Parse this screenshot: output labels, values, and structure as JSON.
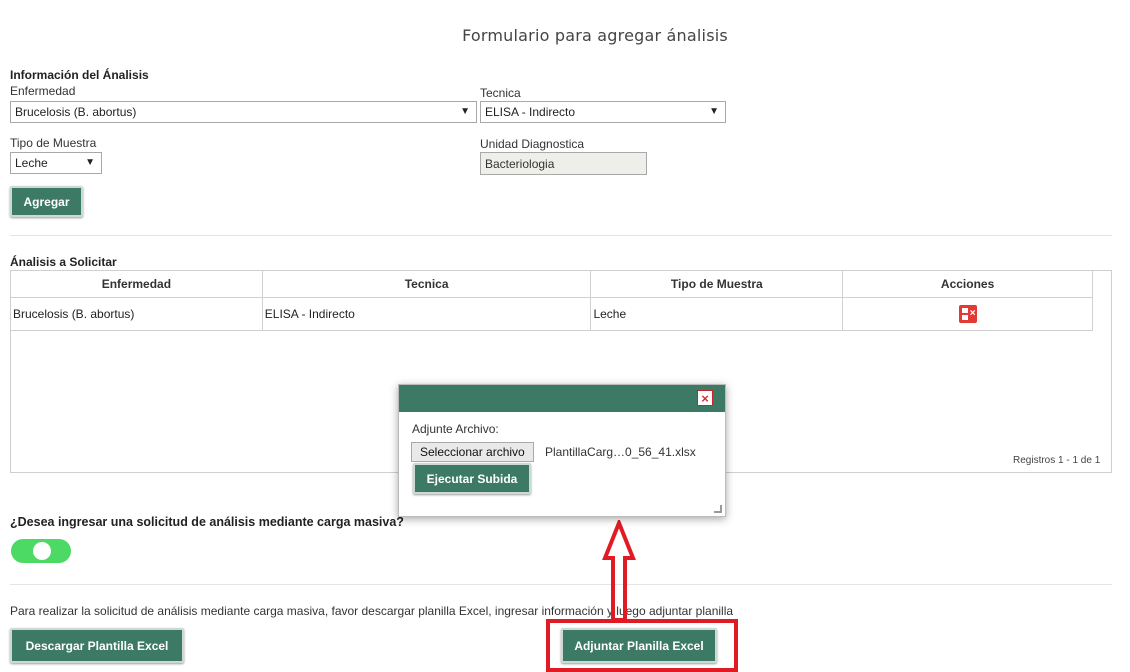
{
  "header": {
    "title": "Formulario para agregar ánalisis"
  },
  "analysis_info": {
    "section_title": "Información del Ánalisis",
    "disease_label": "Enfermedad",
    "disease_value": "Brucelosis (B. abortus)",
    "technique_label": "Tecnica",
    "technique_value": "ELISA - Indirecto",
    "sample_type_label": "Tipo de Muestra",
    "sample_type_value": "Leche",
    "diag_unit_label": "Unidad Diagnostica",
    "diag_unit_value": "Bacteriologia",
    "add_button": "Agregar",
    "caret": "▼"
  },
  "requested": {
    "section_title": "Ánalisis a Solicitar",
    "columns": [
      "Enfermedad",
      "Tecnica",
      "Tipo de Muestra",
      "Acciones"
    ],
    "rows": [
      {
        "disease": "Brucelosis (B. abortus)",
        "technique": "ELISA - Indirecto",
        "sample": "Leche",
        "action_icon": "delete-icon"
      }
    ],
    "records_text": "Registros 1 - 1 de 1"
  },
  "bulk": {
    "question": "¿Desea ingresar una solicitud de análisis mediante carga masiva?",
    "toggle_on": true,
    "instructions": "Para realizar la solicitud de análisis mediante carga masiva, favor descargar planilla Excel, ingresar información y luego adjuntar planilla",
    "download_button": "Descargar Plantilla Excel",
    "attach_button": "Adjuntar Planilla Excel"
  },
  "dialog": {
    "label": "Adjunte Archivo:",
    "choose_file_button": "Seleccionar archivo",
    "file_name": "PlantillaCarg…0_56_41.xlsx",
    "upload_button": "Ejecutar Subida",
    "close_icon": "×"
  },
  "colors": {
    "primary": "#3d7a66",
    "toggle": "#4cd964",
    "highlight": "#e01b24",
    "delete": "#e53935"
  }
}
